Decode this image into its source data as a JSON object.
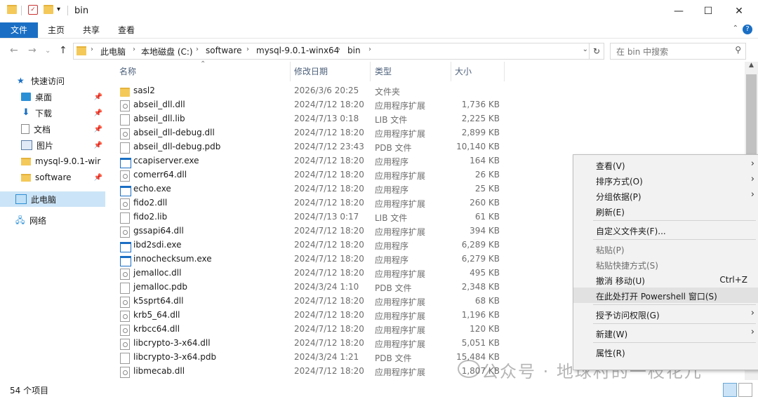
{
  "window": {
    "title": "bin"
  },
  "ribbon": {
    "tabs": [
      "文件",
      "主页",
      "共享",
      "查看"
    ]
  },
  "address": {
    "crumbs": [
      "此电脑",
      "本地磁盘 (C:)",
      "software",
      "mysql-9.0.1-winx64",
      "bin"
    ],
    "search_placeholder": "在 bin 中搜索"
  },
  "nav": {
    "quick_access": "快速访问",
    "pinned": [
      "桌面",
      "下载",
      "文档",
      "图片",
      "mysql-9.0.1-wir",
      "software"
    ],
    "this_pc": "此电脑",
    "network": "网络"
  },
  "columns": {
    "name": "名称",
    "date": "修改日期",
    "type": "类型",
    "size": "大小"
  },
  "files": [
    {
      "name": "sasl2",
      "date": "2026/3/6 20:25",
      "type": "文件夹",
      "size": "",
      "icon": "folder"
    },
    {
      "name": "abseil_dll.dll",
      "date": "2024/7/12 18:20",
      "type": "应用程序扩展",
      "size": "1,736 KB",
      "icon": "dll"
    },
    {
      "name": "abseil_dll.lib",
      "date": "2024/7/13 0:18",
      "type": "LIB 文件",
      "size": "2,225 KB",
      "icon": "doc"
    },
    {
      "name": "abseil_dll-debug.dll",
      "date": "2024/7/12 18:20",
      "type": "应用程序扩展",
      "size": "2,899 KB",
      "icon": "dll"
    },
    {
      "name": "abseil_dll-debug.pdb",
      "date": "2024/7/12 23:43",
      "type": "PDB 文件",
      "size": "10,140 KB",
      "icon": "doc"
    },
    {
      "name": "ccapiserver.exe",
      "date": "2024/7/12 18:20",
      "type": "应用程序",
      "size": "164 KB",
      "icon": "exe"
    },
    {
      "name": "comerr64.dll",
      "date": "2024/7/12 18:20",
      "type": "应用程序扩展",
      "size": "26 KB",
      "icon": "dll"
    },
    {
      "name": "echo.exe",
      "date": "2024/7/12 18:20",
      "type": "应用程序",
      "size": "25 KB",
      "icon": "exe"
    },
    {
      "name": "fido2.dll",
      "date": "2024/7/12 18:20",
      "type": "应用程序扩展",
      "size": "260 KB",
      "icon": "dll"
    },
    {
      "name": "fido2.lib",
      "date": "2024/7/13 0:17",
      "type": "LIB 文件",
      "size": "61 KB",
      "icon": "doc"
    },
    {
      "name": "gssapi64.dll",
      "date": "2024/7/12 18:20",
      "type": "应用程序扩展",
      "size": "394 KB",
      "icon": "dll"
    },
    {
      "name": "ibd2sdi.exe",
      "date": "2024/7/12 18:20",
      "type": "应用程序",
      "size": "6,289 KB",
      "icon": "exe"
    },
    {
      "name": "innochecksum.exe",
      "date": "2024/7/12 18:20",
      "type": "应用程序",
      "size": "6,279 KB",
      "icon": "exe"
    },
    {
      "name": "jemalloc.dll",
      "date": "2024/7/12 18:20",
      "type": "应用程序扩展",
      "size": "495 KB",
      "icon": "dll"
    },
    {
      "name": "jemalloc.pdb",
      "date": "2024/3/24 1:10",
      "type": "PDB 文件",
      "size": "2,348 KB",
      "icon": "doc"
    },
    {
      "name": "k5sprt64.dll",
      "date": "2024/7/12 18:20",
      "type": "应用程序扩展",
      "size": "68 KB",
      "icon": "dll"
    },
    {
      "name": "krb5_64.dll",
      "date": "2024/7/12 18:20",
      "type": "应用程序扩展",
      "size": "1,196 KB",
      "icon": "dll"
    },
    {
      "name": "krbcc64.dll",
      "date": "2024/7/12 18:20",
      "type": "应用程序扩展",
      "size": "120 KB",
      "icon": "dll"
    },
    {
      "name": "libcrypto-3-x64.dll",
      "date": "2024/7/12 18:20",
      "type": "应用程序扩展",
      "size": "5,051 KB",
      "icon": "dll"
    },
    {
      "name": "libcrypto-3-x64.pdb",
      "date": "2024/3/24 1:21",
      "type": "PDB 文件",
      "size": "15,484 KB",
      "icon": "doc"
    },
    {
      "name": "libmecab.dll",
      "date": "2024/7/12 18:20",
      "type": "应用程序扩展",
      "size": "1,807 KB",
      "icon": "dll"
    }
  ],
  "status": {
    "count": "54 个项目"
  },
  "context_menu": [
    {
      "label": "查看(V)",
      "arrow": true
    },
    {
      "label": "排序方式(O)",
      "arrow": true
    },
    {
      "label": "分组依据(P)",
      "arrow": true
    },
    {
      "label": "刷新(E)"
    },
    {
      "sep": true
    },
    {
      "label": "自定义文件夹(F)..."
    },
    {
      "sep": true
    },
    {
      "label": "粘贴(P)",
      "disabled": true
    },
    {
      "label": "粘贴快捷方式(S)",
      "disabled": true
    },
    {
      "label": "撤消 移动(U)",
      "shortcut": "Ctrl+Z"
    },
    {
      "label": "在此处打开 Powershell 窗口(S)",
      "highlight": true
    },
    {
      "sep": true
    },
    {
      "label": "授予访问权限(G)",
      "arrow": true
    },
    {
      "sep": true
    },
    {
      "label": "新建(W)",
      "arrow": true
    },
    {
      "sep": true
    },
    {
      "label": "属性(R)"
    }
  ],
  "watermark": "公众号 · 地球村的一枝花儿",
  "colors": {
    "accent": "#1a6fc4",
    "selection": "#cce4f7"
  }
}
